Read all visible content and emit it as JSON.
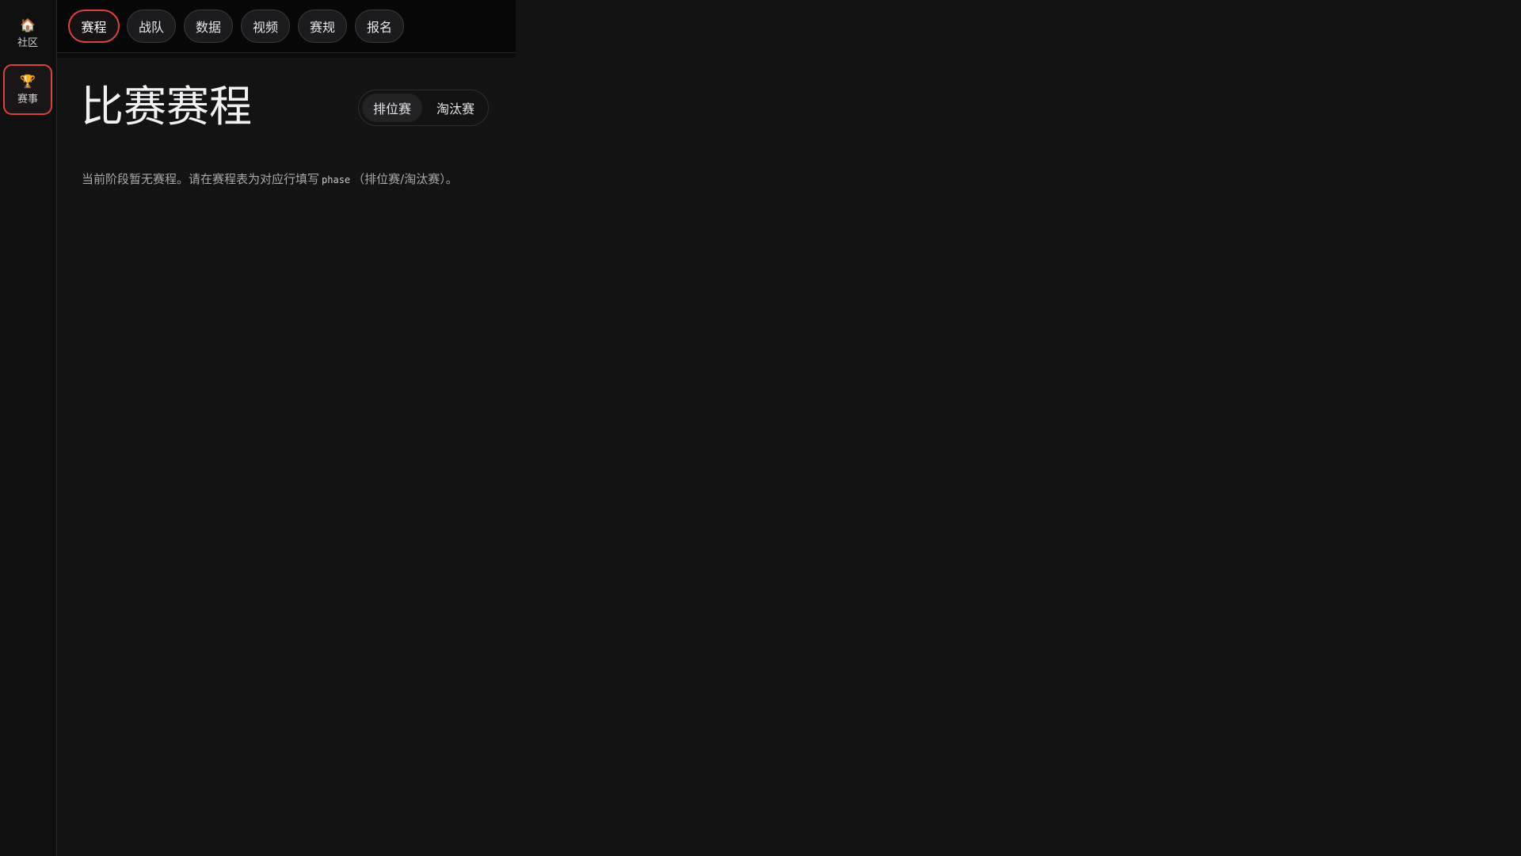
{
  "sidebar": {
    "items": [
      {
        "label": "社区",
        "icon": "home-icon",
        "glyph": "🏠"
      },
      {
        "label": "赛事",
        "icon": "trophy-icon",
        "glyph": "🏆",
        "active": true
      }
    ]
  },
  "tabs": [
    {
      "label": "赛程",
      "active": true
    },
    {
      "label": "战队"
    },
    {
      "label": "数据"
    },
    {
      "label": "视频"
    },
    {
      "label": "赛规"
    },
    {
      "label": "报名"
    }
  ],
  "main": {
    "title": "比赛赛程",
    "phase_toggle": {
      "options": [
        "排位赛",
        "淘汰赛"
      ],
      "selected": "排位赛"
    },
    "empty_message": {
      "before": "当前阶段暂无赛程。请在赛程表为对应行填写",
      "code": "phase",
      "after": "（排位赛/淘汰赛）。"
    }
  },
  "colors": {
    "accent": "#d9433e",
    "background": "#131314",
    "topbar": "#070707"
  }
}
